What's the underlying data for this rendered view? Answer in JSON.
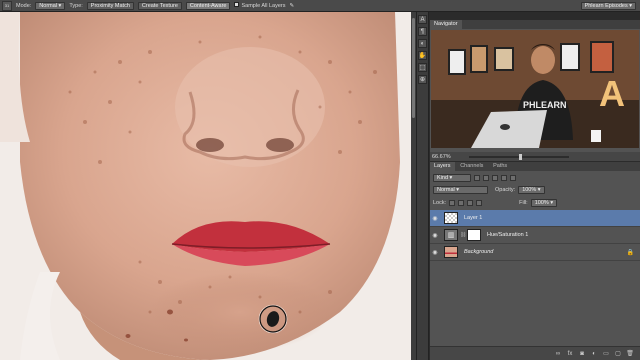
{
  "options_bar": {
    "tool_preset": "31",
    "mode_label": "Mode:",
    "mode_value": "Normal",
    "type_label": "Type:",
    "type_options": [
      "Proximity Match",
      "Create Texture",
      "Content-Aware"
    ],
    "sample_all_layers": "Sample All Layers",
    "workspace": "Phlearn Episodes"
  },
  "tools": [
    "tool-type-icon",
    "tool-path-icon",
    "tool-shape-icon",
    "tool-hand-icon",
    "tool-3d-icon",
    "tool-zoom-icon"
  ],
  "navigator": {
    "tab": "Navigator",
    "zoom": "66.67%",
    "shirt_text": "PHLEARN",
    "sign_letter": "A"
  },
  "layers_panel": {
    "tabs": [
      "Layers",
      "Channels",
      "Paths"
    ],
    "filter_kind": "Kind",
    "blend_mode": "Normal",
    "opacity_label": "Opacity:",
    "opacity_value": "100%",
    "lock_label": "Lock:",
    "fill_label": "Fill:",
    "fill_value": "100%",
    "layers": [
      {
        "name": "Layer 1",
        "selected": true
      },
      {
        "name": "Hue/Saturation 1",
        "selected": false
      },
      {
        "name": "Background",
        "selected": false
      }
    ]
  },
  "colors": {
    "panel_bg": "#535353",
    "selected_layer": "#5b7bab",
    "lip": "#c2303d"
  }
}
